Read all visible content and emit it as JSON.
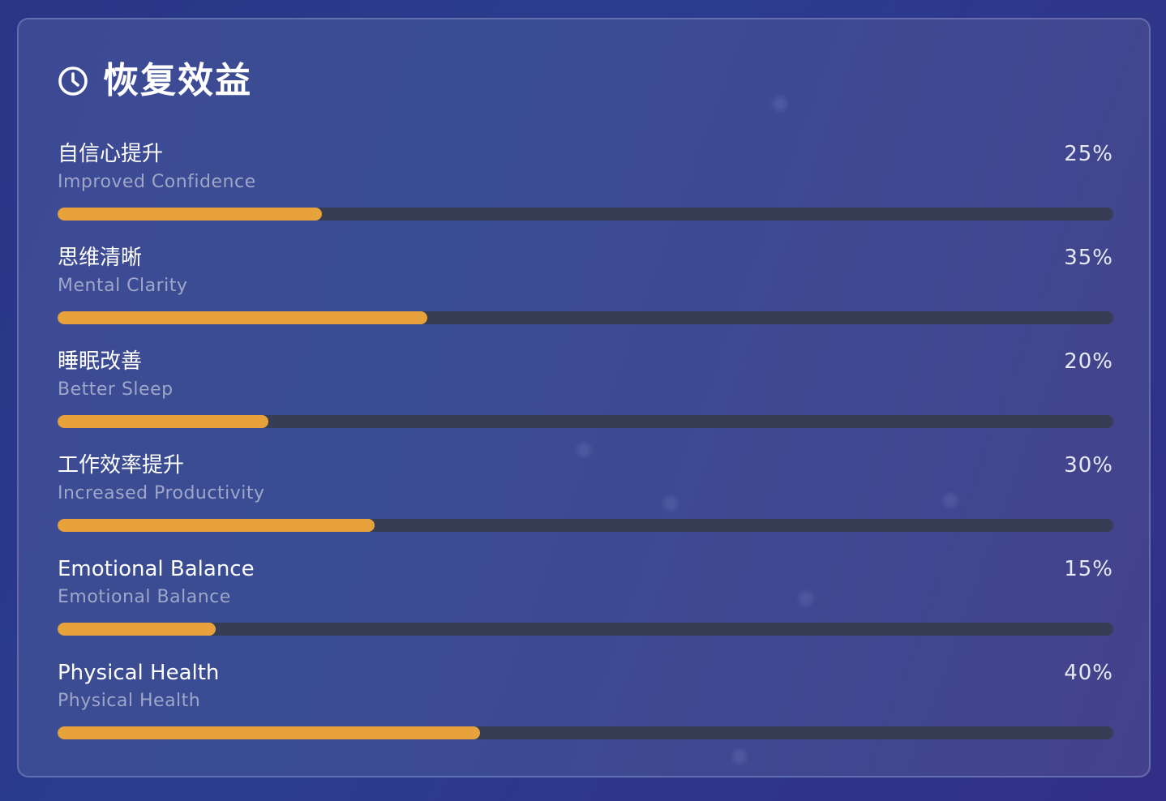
{
  "card": {
    "title": "恢复效益",
    "title_icon": "clock-icon"
  },
  "colors": {
    "accent": "#e8a23c",
    "track": "#363d54",
    "label": "#ffffff",
    "sublabel": "#9ea6c9"
  },
  "benefits": [
    {
      "label": "自信心提升",
      "sublabel": "Improved Confidence",
      "percent_text": "25%",
      "percent": 25
    },
    {
      "label": "思维清晰",
      "sublabel": "Mental Clarity",
      "percent_text": "35%",
      "percent": 35
    },
    {
      "label": "睡眠改善",
      "sublabel": "Better Sleep",
      "percent_text": "20%",
      "percent": 20
    },
    {
      "label": "工作效率提升",
      "sublabel": "Increased Productivity",
      "percent_text": "30%",
      "percent": 30
    },
    {
      "label": "Emotional Balance",
      "sublabel": "Emotional Balance",
      "percent_text": "15%",
      "percent": 15
    },
    {
      "label": "Physical Health",
      "sublabel": "Physical Health",
      "percent_text": "40%",
      "percent": 40
    }
  ]
}
